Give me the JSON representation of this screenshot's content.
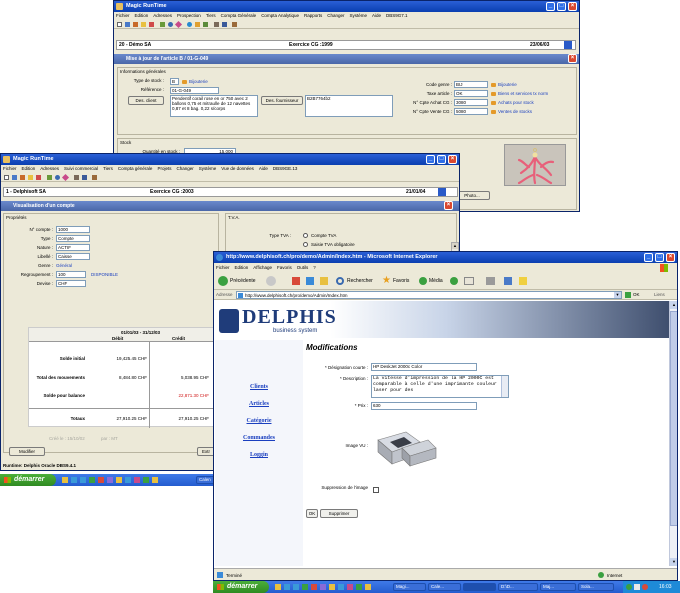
{
  "window1": {
    "title": "Magic RunTime",
    "menu": [
      "Fichier",
      "Edition",
      "Adresses",
      "Prospection",
      "Tiers",
      "Compta Générale",
      "Compta Analytique",
      "Rapports",
      "Changer",
      "Système",
      "Aide",
      "DBS9G7.1"
    ],
    "company": "20 - Démo SA",
    "exercise": "Exercice CG :1999",
    "date": "23/06/03",
    "form_title": "Mise à jour de l'article B / 01-G-049",
    "section_general": "Informations générales",
    "stock_type_label": "Type de stock :",
    "stock_type_value": "B",
    "stock_type_link": "Bijouterie",
    "reference_label": "Référence :",
    "reference_value": "01-G-049",
    "desc_client_btn": "Des. client",
    "desc_client": "Pendentif corail rose en or 750 avec 2 ballons 0,75 et mitraulle de 12 navettes 0,87 et 8 bag. 0,22 s/corps",
    "desc_supplier_btn": "Des. fournisseur",
    "desc_supplier": "B2B7764b2",
    "code_genre_label": "Code genre :",
    "code_genre_value": "BIJ",
    "code_genre_link": "Bijouterie",
    "tax_label": "Taxe article :",
    "tax_value": "OK",
    "tax_link": "Biens et services tx norm",
    "purchase_acct_label": "N° Cpte Achat CG :",
    "purchase_acct_value": "3080",
    "purchase_acct_link": "Achats pour stock",
    "sales_acct_label": "N° Cpte Vente CG :",
    "sales_acct_value": "5080",
    "sales_acct_link": "Ventes de stocks",
    "section_stock": "Stock",
    "qty_label": "Quantité en stock :",
    "qty_value": "15.000",
    "photo_btn": "Photo..."
  },
  "window2": {
    "title": "Magic RunTime",
    "menu": [
      "Fichier",
      "Edition",
      "Adresses",
      "Suivi commercial",
      "Tiers",
      "Compta générale",
      "Projets",
      "Changer",
      "Système",
      "Vue de données",
      "Aide",
      "DBS9GE.13"
    ],
    "company": "1 - Delphisoft SA",
    "exercise": "Exercice CG :2003",
    "date": "21/01/04",
    "form_title": "Visualisation d'un compte",
    "section_props": "Propriétés",
    "section_tva": "T.V.A.",
    "account_label": "N° compte :",
    "account_value": "1000",
    "type_label": "Type :",
    "type_value": "Compte",
    "nature_label": "Nature :",
    "nature_value": "ACTIF",
    "label_label": "Libellé :",
    "label_value": "Caisse",
    "genre_label": "Genre :",
    "genre_value": "Général",
    "group_label": "Regroupement :",
    "group_value": "100",
    "group_link": "DISPONIBLE",
    "currency_label": "Devise :",
    "currency_value": "CHF",
    "tva_type_label": "Type TVA :",
    "tva_option1": "Compte TVA",
    "tva_option2": "Saisie TVA obligatoire",
    "period": "01/01/03 - 31/12/03",
    "col_debit": "Débit",
    "col_credit": "Crédit",
    "rows": [
      {
        "label": "Solde initial",
        "debit": "19,425.45 CHF",
        "credit": ""
      },
      {
        "label": "Total des mouvements",
        "debit": "8,484.80 CHF",
        "credit": "5,038.95 CHF"
      },
      {
        "label": "Solde pour balance",
        "debit": "",
        "credit": "22,871.30 CHF"
      },
      {
        "label": "Totaux",
        "debit": "27,910.25 CHF",
        "credit": "27,910.25 CHF"
      }
    ],
    "created_label": "Créé le : 15/10/02",
    "created_by": "par : MT",
    "modify_btn": "Modifier",
    "status": "Runtime: Delphis Oracle DBS9.4.1"
  },
  "taskbar_back": {
    "start": "démarrer",
    "item": "Calen"
  },
  "ie": {
    "title": "http://www.delphisoft.ch/pro/demo/Admin/Index.htm - Microsoft Internet Explorer",
    "menu": [
      "Fichier",
      "Edition",
      "Affichage",
      "Favoris",
      "Outils",
      "?"
    ],
    "back": "Précédente",
    "search": "Rechercher",
    "favorites": "Favoris",
    "media": "Média",
    "address_label": "Adresse",
    "address": "http://www.delphisoft.ch/pro/demo/Admin/Index.htm",
    "go": "OK",
    "links": "Liens",
    "brand": "DELPHIS",
    "brand_sub": "business system",
    "nav": [
      "Clients",
      "Articles",
      "Catégorie",
      "Commandes",
      "Loggin"
    ],
    "heading": "Modifications",
    "short_desc_label": "* Désignation courte :",
    "short_desc_value": "HP DeskJet 2000c Color",
    "desc_label": "* Description :",
    "desc_value": "La vitesse d'impression de la HP 2000C est comparable à celle d'une imprimante couleur laser pour des",
    "price_label": "* Prix :",
    "price_value": "630",
    "image_label": "Image VU :",
    "delete_label": "Suppression de l'image",
    "ok_btn": "OK",
    "delete_btn": "Supprimer",
    "status_done": "Terminé",
    "status_zone": "Internet"
  },
  "taskbar_front": {
    "start": "démarrer",
    "items": [
      "Magi...",
      "Cale...",
      "",
      "D:\\D...",
      "Maj...",
      "Sola..."
    ],
    "clock": "16:03"
  },
  "colors": {
    "titlebar": "#0a3fb0",
    "link": "#1a3fbf",
    "credit_red": "#d01818",
    "brand_blue": "#1f3c7a",
    "xp_start": "#2f8a22"
  }
}
